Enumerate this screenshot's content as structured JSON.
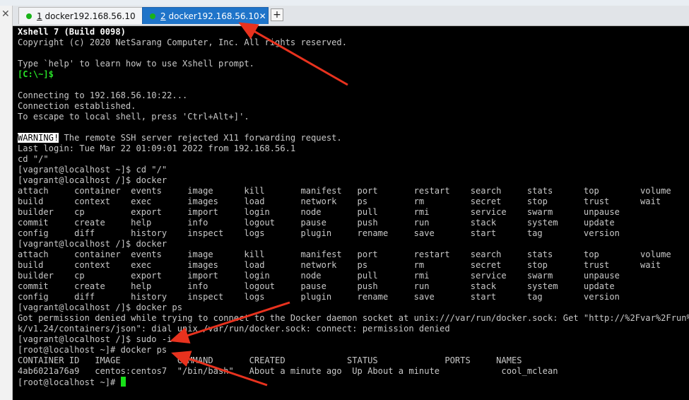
{
  "side": {
    "close_glyph": "✕"
  },
  "tabs": [
    {
      "number": "1",
      "title": " docker192.168.56.10",
      "status_color": "#19b319"
    },
    {
      "number": "2",
      "title": " docker192.168.56.10",
      "status_color": "#19b319"
    }
  ],
  "tab_close_glyph": "✕",
  "add_tab_glyph": "+",
  "colors": {
    "terminal_bg": "#000000",
    "terminal_text": "#c8c8c8",
    "prompt_green": "#28e028",
    "active_tab": "#1f74c9",
    "annotation_arrow": "#e8321e"
  },
  "annotations": [
    "red-arrow-to-tab",
    "red-arrow-to-sudo",
    "red-arrow-to-docker-ps"
  ],
  "terminal": {
    "banner_title": "Xshell 7 (Build 0098)",
    "copyright": "Copyright (c) 2020 NetSarang Computer, Inc. All rights reserved.",
    "help": "Type `help' to learn how to use Xshell prompt.",
    "local_prompt": "[C:\\~]$",
    "connecting": "Connecting to 192.168.56.10:22...",
    "established": "Connection established.",
    "escape": "To escape to local shell, press 'Ctrl+Alt+]'.",
    "warning_tag": "WARNING!",
    "warning_text": " The remote SSH server rejected X11 forwarding request.",
    "last_login": "Last login: Tue Mar 22 01:09:01 2022 from 192.168.56.1",
    "cd_cmd": "cd \"/\"",
    "line_cd": "[vagrant@localhost ~]$ cd \"/\"",
    "line_docker_1": "[vagrant@localhost /]$ docker",
    "cmds1": [
      "attach     container  events     image      kill       manifest   port       restart    search     stats      top        volume",
      "build      context    exec       images     load       network    ps         rm         secret     stop       trust      wait",
      "builder    cp         export     import     login      node       pull       rmi        service    swarm      unpause",
      "commit     create     help       info       logout     pause      push       run        stack      system     update",
      "config     diff       history    inspect    logs       plugin     rename     save       start      tag        version"
    ],
    "line_docker_2": "[vagrant@localhost /]$ docker",
    "cmds2": [
      "attach     container  events     image      kill       manifest   port       restart    search     stats      top        volume",
      "build      context    exec       images     load       network    ps         rm         secret     stop       trust      wait",
      "builder    cp         export     import     login      node       pull       rmi        service    swarm      unpause",
      "commit     create     help       info       logout     pause      push       run        stack      system     update",
      "config     diff       history    inspect    logs       plugin     rename     save       start      tag        version"
    ],
    "line_docker_ps": "[vagrant@localhost /]$ docker ps",
    "perm_1": "Got permission denied while trying to connect to the Docker daemon socket at unix:///var/run/docker.sock: Get \"http://%2Fvar%2Frun%2Fdock",
    "perm_2": "k/v1.24/containers/json\": dial unix /var/run/docker.sock: connect: permission denied",
    "line_sudo": "[vagrant@localhost /]$ sudo -i",
    "line_root_ps": "[root@localhost ~]# docker ps",
    "ps_header": "CONTAINER ID   IMAGE           COMMAND       CREATED            STATUS             PORTS     NAMES",
    "ps_row": "4ab6021a76a9   centos:centos7  \"/bin/bash\"   About a minute ago  Up About a minute            cool_mclean",
    "root_prompt": "[root@localhost ~]# "
  }
}
